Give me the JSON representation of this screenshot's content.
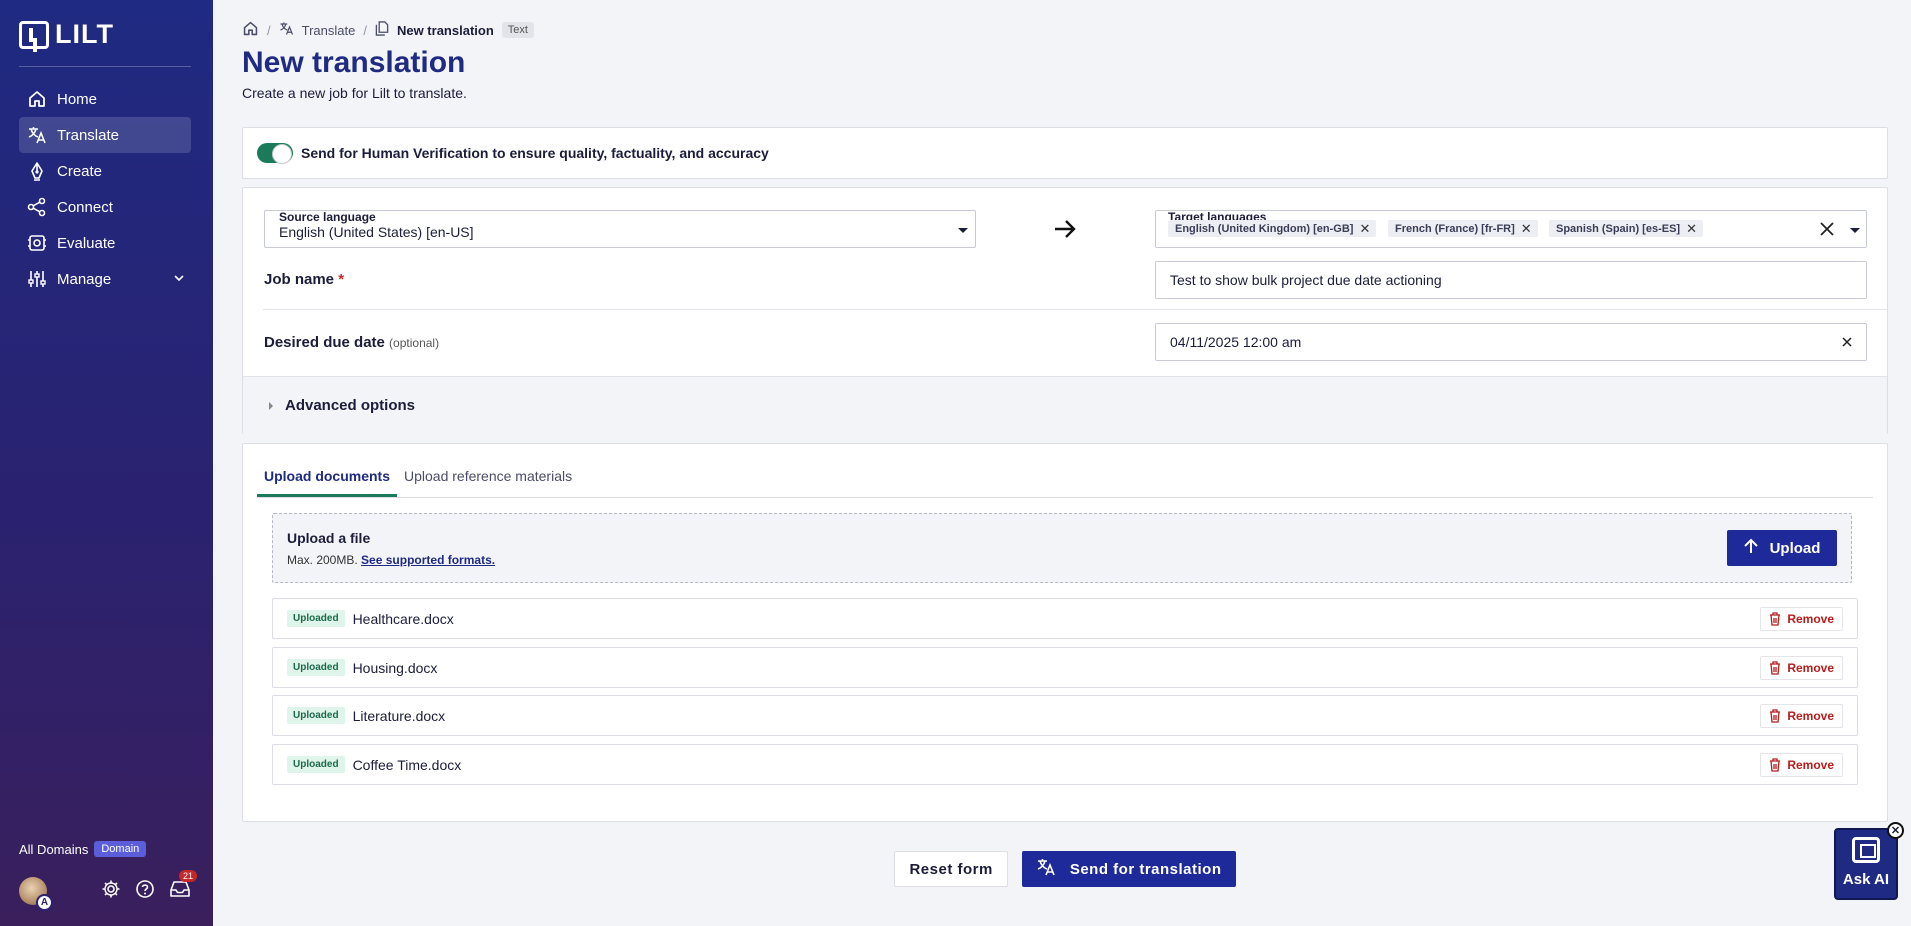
{
  "app": {
    "logo_text": "LILT"
  },
  "sidebar": {
    "items": [
      {
        "label": "Home",
        "icon": "home-icon"
      },
      {
        "label": "Translate",
        "icon": "translate-icon",
        "active": true
      },
      {
        "label": "Create",
        "icon": "pen-icon"
      },
      {
        "label": "Connect",
        "icon": "share-icon"
      },
      {
        "label": "Evaluate",
        "icon": "evaluate-icon"
      },
      {
        "label": "Manage",
        "icon": "sliders-icon"
      }
    ],
    "domain_label": "All Domains",
    "domain_badge": "Domain",
    "avatar_badge": "A",
    "notification_count": "21"
  },
  "breadcrumb": {
    "translate": "Translate",
    "current": "New translation",
    "tag": "Text"
  },
  "page": {
    "title": "New translation",
    "subtitle": "Create a new job for Lilt to translate."
  },
  "human_verification": {
    "label": "Send for Human Verification to ensure quality, factuality, and accuracy",
    "enabled": true
  },
  "form": {
    "source_language_label": "Source language",
    "source_language_value": "English (United States) [en-US]",
    "target_languages_label": "Target languages",
    "target_languages": [
      "English (United Kingdom) [en-GB]",
      "French (France) [fr-FR]",
      "Spanish (Spain) [es-ES]"
    ],
    "job_name_label": "Job name",
    "job_name_required": "*",
    "job_name_value": "Test to show bulk project due date actioning",
    "due_date_label": "Desired due date",
    "due_date_optional": "(optional)",
    "due_date_value": "04/11/2025 12:00 am",
    "advanced_options_label": "Advanced options"
  },
  "upload": {
    "tabs": [
      "Upload documents",
      "Upload reference materials"
    ],
    "dropzone_title": "Upload a file",
    "dropzone_max": "Max. 200MB.",
    "dropzone_link": "See supported formats.",
    "upload_button": "Upload",
    "status_label": "Uploaded",
    "remove_label": "Remove",
    "files": [
      "Healthcare.docx",
      "Housing.docx",
      "Literature.docx",
      "Coffee Time.docx"
    ]
  },
  "footer": {
    "reset_label": "Reset form",
    "send_label": "Send for translation"
  },
  "ask_ai": {
    "label": "Ask AI"
  },
  "colors": {
    "brand": "#1f2a9a",
    "sidebar": "#2a2270",
    "accent_green": "#1b7a5a",
    "danger": "#b71c1c"
  }
}
